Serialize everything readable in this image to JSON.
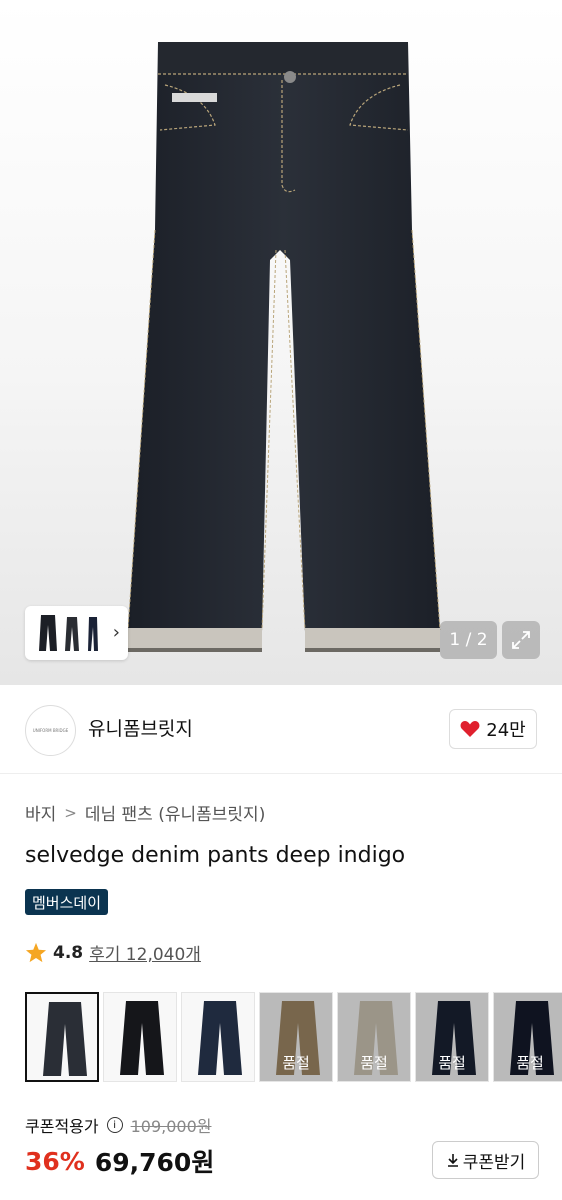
{
  "gallery": {
    "counter": "1 / 2",
    "thumbnail_strip_icon": "jeans-thumbnails",
    "expand_icon": "expand-arrows-icon"
  },
  "brand": {
    "logo_text": "UNIFORM BRIDGE",
    "name": "유니폼브릿지",
    "likes": "24만",
    "heart_color": "#e0202e"
  },
  "breadcrumb": {
    "level1": "바지",
    "level2": "데님 팬츠 (유니폼브릿지)"
  },
  "product": {
    "title": "selvedge denim pants deep indigo",
    "badge": "멤버스데이",
    "badge_color": "#0b3450"
  },
  "rating": {
    "score": "4.8",
    "review_text": "후기 12,040개"
  },
  "variants": [
    {
      "tone": "#2a2e36",
      "sold_out": "",
      "selected": true
    },
    {
      "tone": "#15161a",
      "sold_out": "",
      "selected": false
    },
    {
      "tone": "#1f2a3e",
      "sold_out": "",
      "selected": false
    },
    {
      "tone": "#a08966",
      "sold_out": "품절",
      "selected": false
    },
    {
      "tone": "#cfc7b6",
      "sold_out": "품절",
      "selected": false
    },
    {
      "tone": "#1a2233",
      "sold_out": "품절",
      "selected": false
    },
    {
      "tone": "#141a2b",
      "sold_out": "품절",
      "selected": false
    }
  ],
  "price": {
    "label": "쿠폰적용가",
    "original": "109,000원",
    "discount": "36%",
    "final": "69,760원",
    "coupon_button": "쿠폰받기"
  }
}
